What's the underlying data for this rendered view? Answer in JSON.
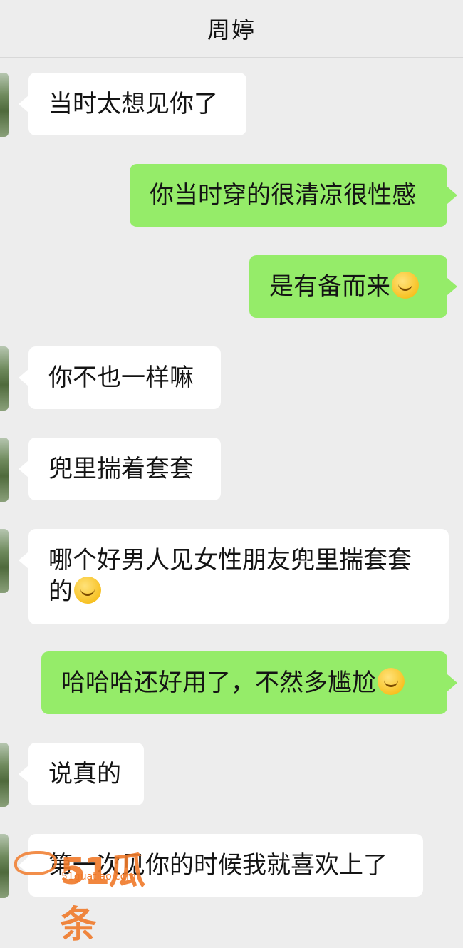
{
  "header": {
    "title": "周婷"
  },
  "messages": [
    {
      "side": "left",
      "text": "当时太想见你了"
    },
    {
      "side": "right",
      "text": "你当时穿的很清凉很性感"
    },
    {
      "side": "right",
      "text": "是有备而来",
      "emoji": "face-emoji"
    },
    {
      "side": "left",
      "text": "你不也一样嘛"
    },
    {
      "side": "left",
      "text": "兜里揣着套套"
    },
    {
      "side": "left",
      "text": "哪个好男人见女性朋友兜里揣套套的",
      "emoji": "face-emoji"
    },
    {
      "side": "right",
      "text": "哈哈哈还好用了，不然多尴尬",
      "emoji": "face-emoji"
    },
    {
      "side": "left",
      "text": "说真的"
    },
    {
      "side": "left",
      "text": "第一次见你的时候我就喜欢上了"
    }
  ],
  "watermark": {
    "logo_text": "51瓜条",
    "site_text": "51guatiao.com"
  }
}
